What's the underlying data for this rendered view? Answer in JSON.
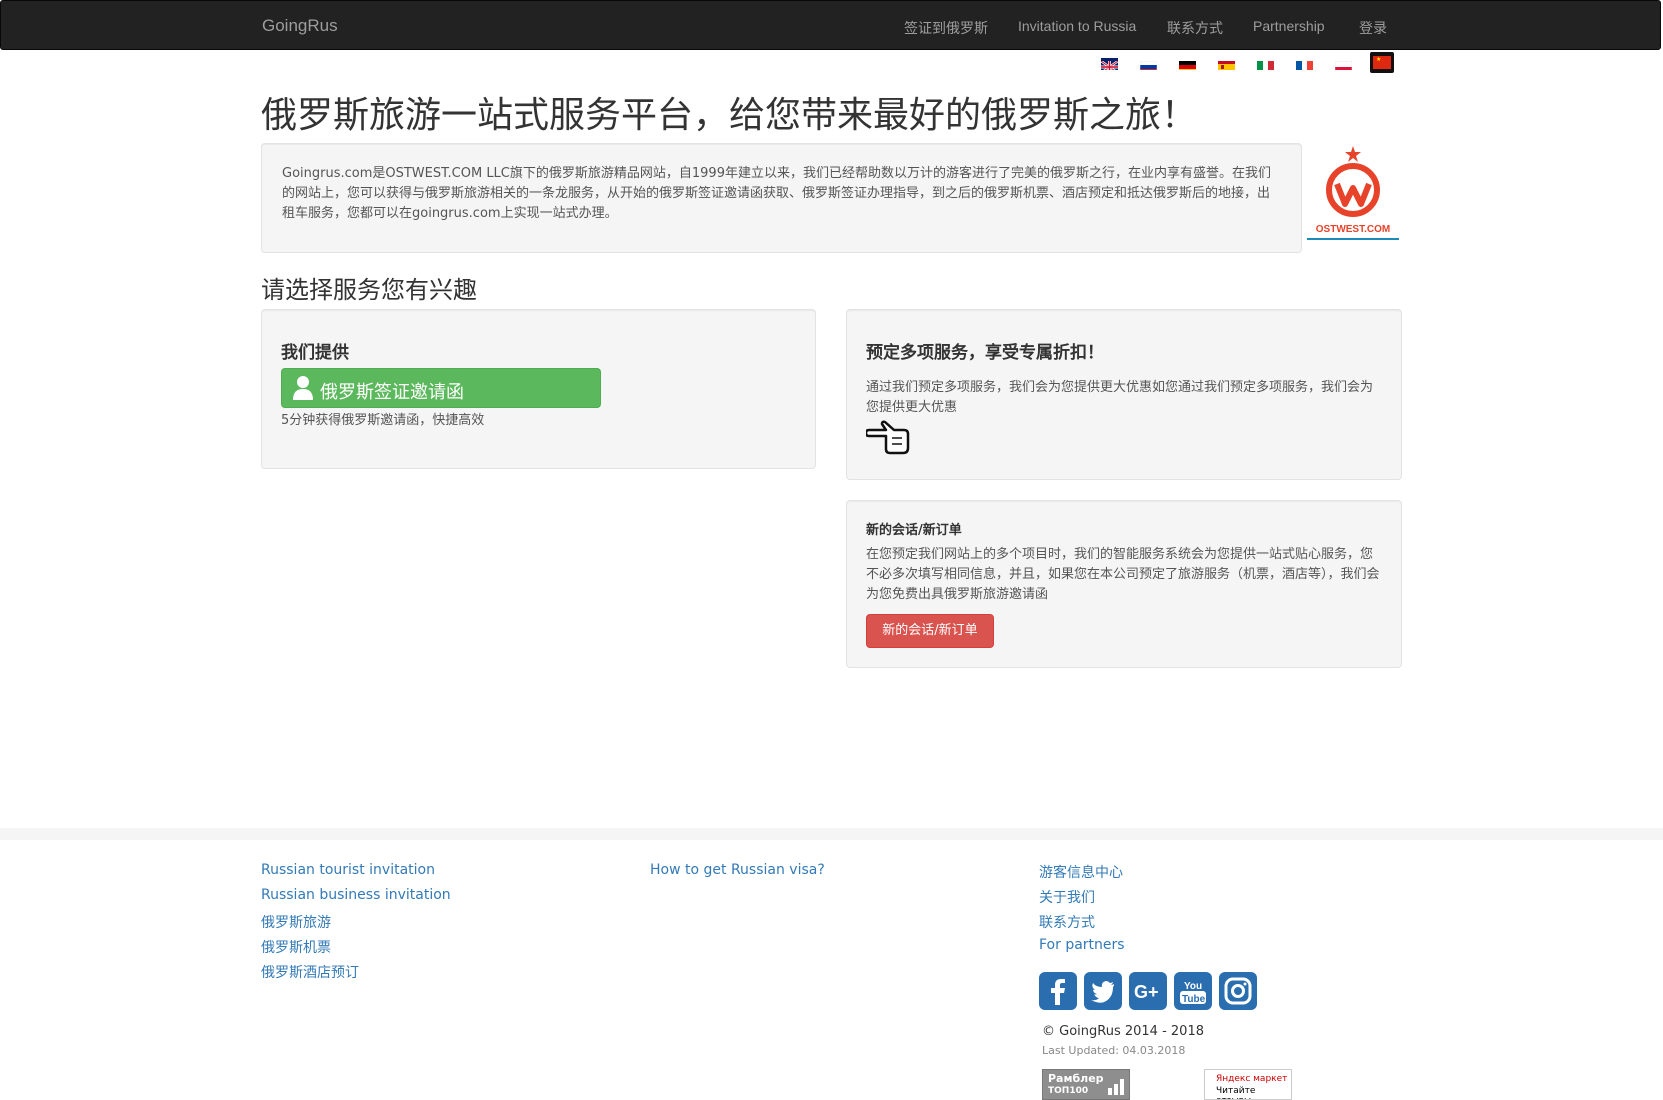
{
  "navbar": {
    "brand": "GoingRus",
    "items": [
      "签证到俄罗斯",
      "Invitation to Russia",
      "联系方式",
      "Partnership",
      "登录"
    ]
  },
  "languages": [
    "English",
    "Русский",
    "Deutsch",
    "Español",
    "Italiano",
    "Français",
    "Polski",
    "中文"
  ],
  "hero": {
    "title": "俄罗斯旅游一站式服务平台，给您带来最好的俄罗斯之旅！",
    "intro": "Goingrus.com是OSTWEST.COM LLC旗下的俄罗斯旅游精品网站，自1999年建立以来，我们已经帮助数以万计的游客进行了完美的俄罗斯之行，在业内享有盛誉。在我们的网站上，您可以获得与俄罗斯旅游相关的一条龙服务，从开始的俄罗斯签证邀请函获取、俄罗斯签证办理指导，到之后的俄罗斯机票、酒店预定和抵达俄罗斯后的地接，出租车服务，您都可以在goingrus.com上实现一站式办理。",
    "logo_text": "OSTWEST.COM"
  },
  "section_title": "请选择服务您有兴趣",
  "cards": {
    "offer": {
      "heading": "我们提供",
      "button": "俄罗斯签证邀请函",
      "subtext": "5分钟获得俄罗斯邀请函，快捷高效"
    },
    "multi": {
      "heading": "预定多项服务，享受专属折扣！",
      "text": "通过我们预定多项服务，我们会为您提供更大优惠如您通过我们预定多项服务，我们会为您提供更大优惠"
    },
    "session": {
      "heading": "新的会话/新订单",
      "text": "在您预定我们网站上的多个项目时，我们的智能服务系统会为您提供一站式贴心服务，您不必多次填写相同信息，并且，如果您在本公司预定了旅游服务（机票，酒店等），我们会为您免费出具俄罗斯旅游邀请函",
      "button": "新的会话/新订单"
    }
  },
  "footer": {
    "col1": [
      "Russian tourist invitation",
      "Russian business invitation",
      "俄罗斯旅游",
      "俄罗斯机票",
      "俄罗斯酒店预订"
    ],
    "col2": [
      "How to get Russian visa?"
    ],
    "col3": [
      "游客信息中心",
      "关于我们",
      "联系方式",
      "For partners"
    ],
    "social": [
      "facebook-icon",
      "twitter-icon",
      "google-plus-icon",
      "youtube-icon",
      "instagram-icon"
    ],
    "copyright": "© GoingRus 2014 - 2018",
    "updated": "Last Updated: 04.03.2018",
    "badge_rambler_1": "Рамблер",
    "badge_rambler_2": "ТОП100",
    "badge_yandex_1": "Яндекс маркет",
    "badge_yandex_2": "Читайте отзывы"
  }
}
